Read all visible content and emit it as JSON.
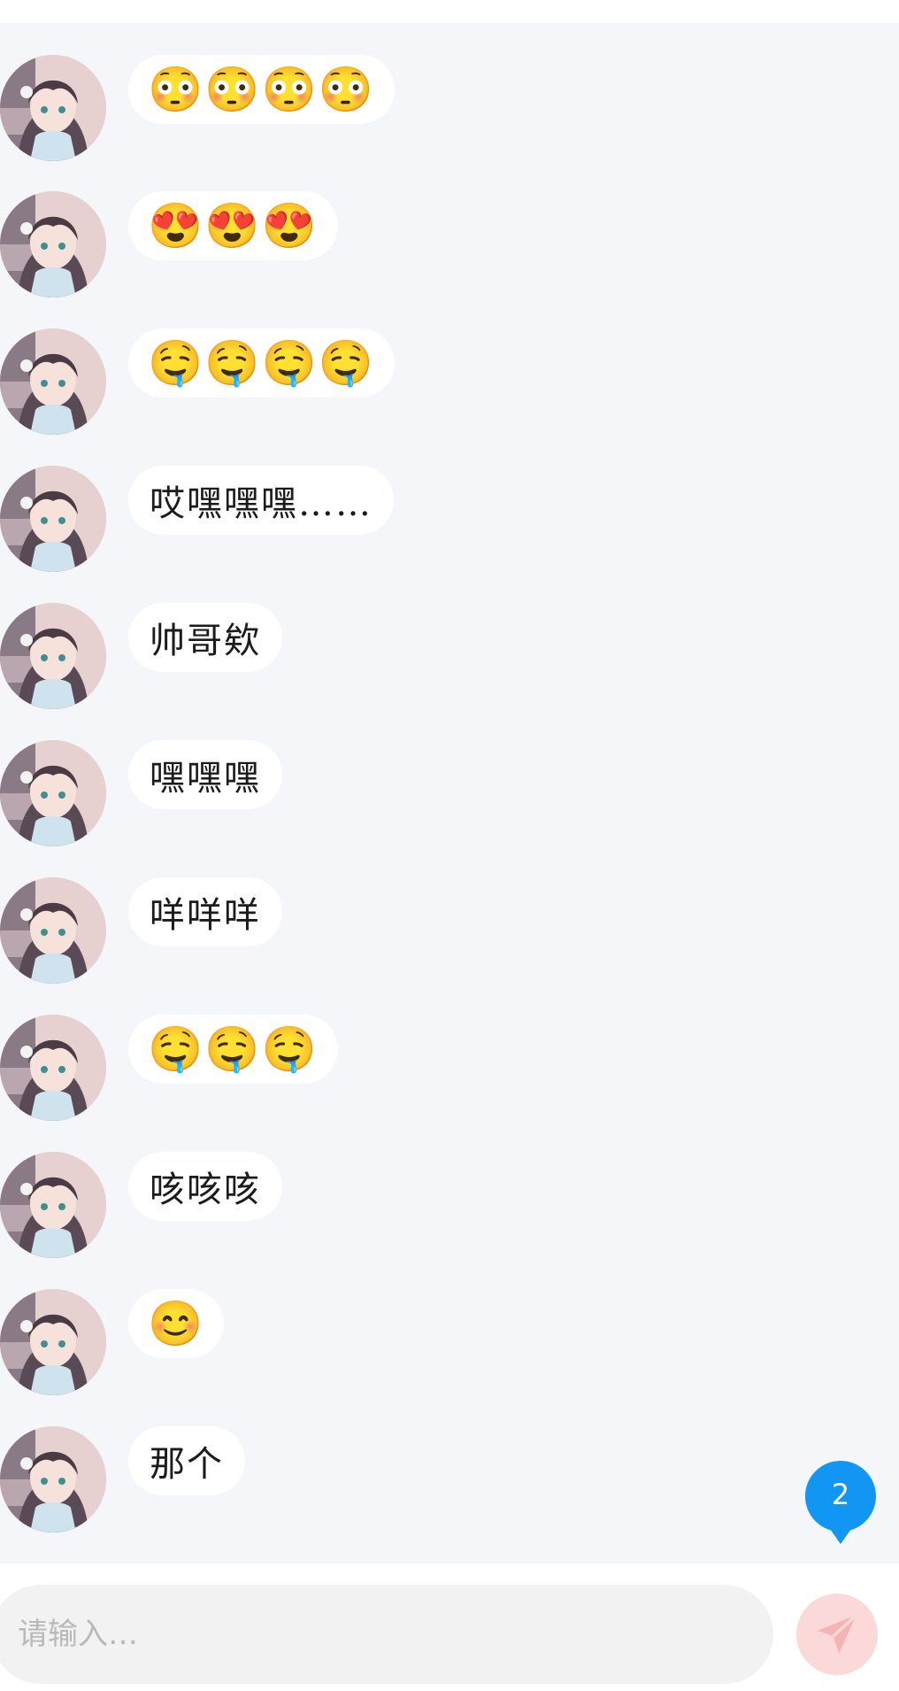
{
  "messages": [
    {
      "text": "😳😳😳😳",
      "kind": "emoji"
    },
    {
      "text": "😍😍😍",
      "kind": "emoji"
    },
    {
      "text": "🤤🤤🤤🤤",
      "kind": "emoji"
    },
    {
      "text": "哎嘿嘿嘿……",
      "kind": "text"
    },
    {
      "text": "帅哥欸",
      "kind": "text"
    },
    {
      "text": "嘿嘿嘿",
      "kind": "text"
    },
    {
      "text": "咩咩咩",
      "kind": "text"
    },
    {
      "text": "🤤🤤🤤",
      "kind": "emoji"
    },
    {
      "text": "咳咳咳",
      "kind": "text"
    },
    {
      "text": "😊",
      "kind": "emoji"
    },
    {
      "text": "那个",
      "kind": "text"
    }
  ],
  "unread_badge": "2",
  "composer": {
    "placeholder": "请输入…",
    "send_icon": "paper-plane-icon"
  },
  "colors": {
    "chat_bg": "#f4f6f9",
    "bubble_bg": "#ffffff",
    "badge": "#1296f3",
    "send_button": "#fbd9d9",
    "send_icon": "#f5b4b4"
  }
}
